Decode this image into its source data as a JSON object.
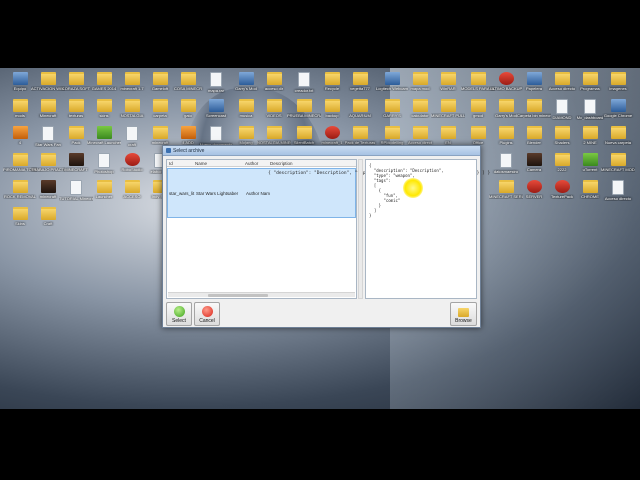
{
  "dialog": {
    "title": "Select archive",
    "columns": [
      "Id",
      "Name",
      "Author",
      "Description"
    ],
    "selected_row": {
      "id": "star_wars_lit",
      "name": "Star Wars Lightsaber",
      "author": "Author Nam",
      "description": "{\n  \"description\": \"Description\",\n  \"type\": \"weapon\",\n  \"tags\": [\n    {\n      \"fun\",\n      \"comic\"\n    }\n  ]\n}"
    },
    "json_preview": "{\n  \"description\": \"Description\",\n  \"type\": \"weapon\",\n  \"tags\":\n  [\n    {\n      \"fun\",\n      \"comic\"\n    }\n  ]\n}",
    "buttons": {
      "select": "Select",
      "cancel": "Cancel",
      "browse": "Browse"
    }
  },
  "desktop_icons": [
    {
      "label": "Equipo",
      "type": "exe"
    },
    {
      "label": "ACTIVACION WIN 8",
      "type": "folder"
    },
    {
      "label": "CORAZA SOFT",
      "type": "folder"
    },
    {
      "label": "GAMES 2014",
      "type": "folder"
    },
    {
      "label": "minecraft 1.7",
      "type": "folder"
    },
    {
      "label": "Gameloft",
      "type": "folder"
    },
    {
      "label": "COSA MINECR",
      "type": "folder"
    },
    {
      "label": "mapa.rar",
      "type": "doc"
    },
    {
      "label": "Garry's Mod",
      "type": "exe"
    },
    {
      "label": "acceso dir",
      "type": "folder"
    },
    {
      "label": "creador.txt",
      "type": "doc"
    },
    {
      "label": "Recycle",
      "type": "folder"
    },
    {
      "label": "vegetta777",
      "type": "folder"
    },
    {
      "label": "Logitech Webcam",
      "type": "exe"
    },
    {
      "label": "mapa mod",
      "type": "folder"
    },
    {
      "label": "WinRAR",
      "type": "folder"
    },
    {
      "label": "MODELS PARA SOURCE",
      "type": "folder"
    },
    {
      "label": "ULTIMO BACKUP",
      "type": "red"
    },
    {
      "label": "Papelera",
      "type": "exe"
    },
    {
      "label": "Acceso directo",
      "type": "folder"
    },
    {
      "label": "Programas",
      "type": "folder"
    },
    {
      "label": "imagenes",
      "type": "folder"
    },
    {
      "label": "mods",
      "type": "folder"
    },
    {
      "label": "Minecraft",
      "type": "folder"
    },
    {
      "label": "texturas",
      "type": "folder"
    },
    {
      "label": "skins",
      "type": "folder"
    },
    {
      "label": "NOSTALGIA",
      "type": "folder"
    },
    {
      "label": "carpeta",
      "type": "folder"
    },
    {
      "label": "gato",
      "type": "folder"
    },
    {
      "label": "Screencast",
      "type": "exe"
    },
    {
      "label": "musica",
      "type": "folder"
    },
    {
      "label": "VIDEOS",
      "type": "folder"
    },
    {
      "label": "PRUEBA MINECRAFT",
      "type": "folder"
    },
    {
      "label": "backup",
      "type": "folder"
    },
    {
      "label": "AQUARIUM",
      "type": "folder"
    },
    {
      "label": "GARRY'S",
      "type": "folder"
    },
    {
      "label": "calculator",
      "type": "folder"
    },
    {
      "label": "MINECRAFT PULLLM",
      "type": "folder"
    },
    {
      "label": "gmod",
      "type": "folder"
    },
    {
      "label": "Garry's Mod",
      "type": "folder"
    },
    {
      "label": "Carpeta bin minecraft",
      "type": "folder"
    },
    {
      "label": "DIAMOND",
      "type": "doc"
    },
    {
      "label": "Mc_dashboard",
      "type": "doc"
    },
    {
      "label": "Google Chrome",
      "type": "exe"
    },
    {
      "label": "4",
      "type": "orange"
    },
    {
      "label": "Star Wars Fan",
      "type": "doc"
    },
    {
      "label": "Pack",
      "type": "folder"
    },
    {
      "label": "Minecraft Launcher",
      "type": "green"
    },
    {
      "label": "craft",
      "type": "doc"
    },
    {
      "label": "minecraft",
      "type": "folder"
    },
    {
      "label": "4 ADD",
      "type": "orange"
    },
    {
      "label": "Nuevo documento",
      "type": "doc"
    },
    {
      "label": "Mojang",
      "type": "folder"
    },
    {
      "label": "NOSTALGIA MINECRAFT",
      "type": "folder"
    },
    {
      "label": "SilentBatch",
      "type": "folder"
    },
    {
      "label": "minecraft_1",
      "type": "red"
    },
    {
      "label": "Pack de Texturas",
      "type": "folder"
    },
    {
      "label": "RPModelling",
      "type": "folder"
    },
    {
      "label": "Acceso direct",
      "type": "folder"
    },
    {
      "label": "EN",
      "type": "folder"
    },
    {
      "label": "Office",
      "type": "folder"
    },
    {
      "label": "Plugins",
      "type": "folder"
    },
    {
      "label": "Blender",
      "type": "folder"
    },
    {
      "label": "Shaders",
      "type": "folder"
    },
    {
      "label": "2 MINE",
      "type": "folder"
    },
    {
      "label": "Nueva carpeta",
      "type": "folder"
    },
    {
      "label": "PIROMANIA TORRENT",
      "type": "folder"
    },
    {
      "label": "TRABAJO PRACTICO",
      "type": "folder"
    },
    {
      "label": "MINECRAFT",
      "type": "dark"
    },
    {
      "label": "Photoshop",
      "type": "doc"
    },
    {
      "label": "RoboStudio",
      "type": "red"
    },
    {
      "label": "elaborated",
      "type": "doc"
    },
    {
      "label": "datosmaestro",
      "type": "doc"
    },
    {
      "label": "Camera",
      "type": "dark"
    },
    {
      "label": "2222",
      "type": "folder"
    },
    {
      "label": "uTorrent",
      "type": "green"
    },
    {
      "label": "MINECRAFT MODE",
      "type": "folder"
    },
    {
      "label": "ROCK REMOVAL",
      "type": "folder"
    },
    {
      "label": "minecraft",
      "type": "dark"
    },
    {
      "label": "TUTORIAL Minecraft",
      "type": "doc"
    },
    {
      "label": "Launcher",
      "type": "folder"
    },
    {
      "label": "ACCESO",
      "type": "folder"
    },
    {
      "label": "Indy Skel",
      "type": "folder"
    },
    {
      "label": "MINECRAFT SERIAL",
      "type": "folder"
    },
    {
      "label": "SERVER",
      "type": "red"
    },
    {
      "label": "TexturePack",
      "type": "red"
    },
    {
      "label": "CHROME",
      "type": "folder"
    },
    {
      "label": "Acceso directo",
      "type": "doc"
    },
    {
      "label": "Skins",
      "type": "folder"
    },
    {
      "label": "Craft",
      "type": "folder"
    }
  ]
}
